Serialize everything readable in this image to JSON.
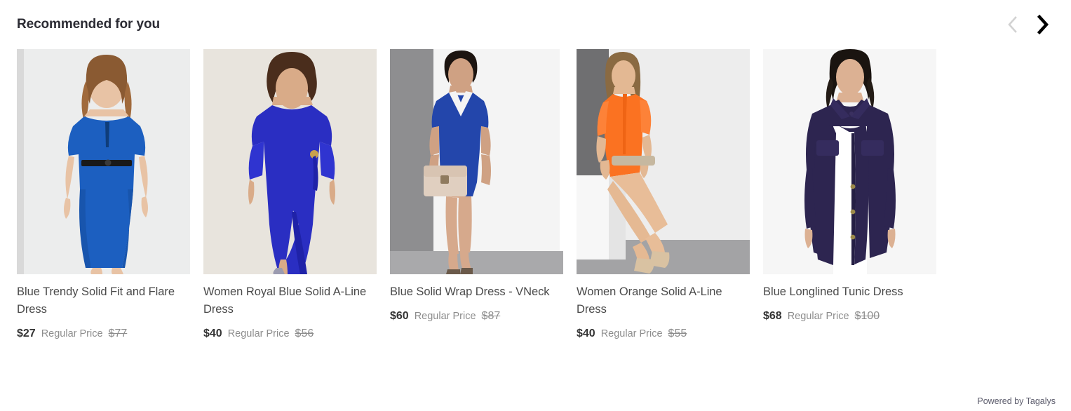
{
  "header": {
    "title": "Recommended for you",
    "prev_arrow": "chevron-left-icon",
    "next_arrow": "chevron-right-icon",
    "prev_color": "#d2d2d2",
    "next_color": "#000000"
  },
  "products": [
    {
      "title": "Blue Trendy Solid Fit and Flare Dress",
      "special_price": "$27",
      "price_label": "Regular Price",
      "regular_price": "$77",
      "image_alt": "model in royal blue fit and flare dress with black belt",
      "bg_color": "#eceded",
      "garment_color": "#1c5fc0"
    },
    {
      "title": "Women Royal Blue Solid A-Line Dress",
      "special_price": "$40",
      "price_label": "Regular Price",
      "regular_price": "$56",
      "image_alt": "model with curly hair in long royal blue A-line dress",
      "bg_color": "#e8e4dd",
      "garment_color": "#2a2ec2"
    },
    {
      "title": "Blue Solid Wrap Dress - VNeck",
      "special_price": "$60",
      "price_label": "Regular Price",
      "regular_price": "$87",
      "image_alt": "model in blue v-neck wrap dress holding beige clutch",
      "bg_color": "#8e8e90",
      "garment_color": "#2346ab"
    },
    {
      "title": "Women Orange Solid A-Line Dress",
      "special_price": "$40",
      "price_label": "Regular Price",
      "regular_price": "$55",
      "image_alt": "model seated on white cube in orange cold shoulder dress",
      "bg_color": "#ededed",
      "garment_color": "#fb7221"
    },
    {
      "title": "Blue Longlined Tunic Dress",
      "special_price": "$68",
      "price_label": "Regular Price",
      "regular_price": "$100",
      "image_alt": "model in dark navy longline tunic dress with white pants",
      "bg_color": "#f6f6f6",
      "garment_color": "#2d2550"
    }
  ],
  "footer": {
    "powered_by": "Powered by Tagalys"
  }
}
